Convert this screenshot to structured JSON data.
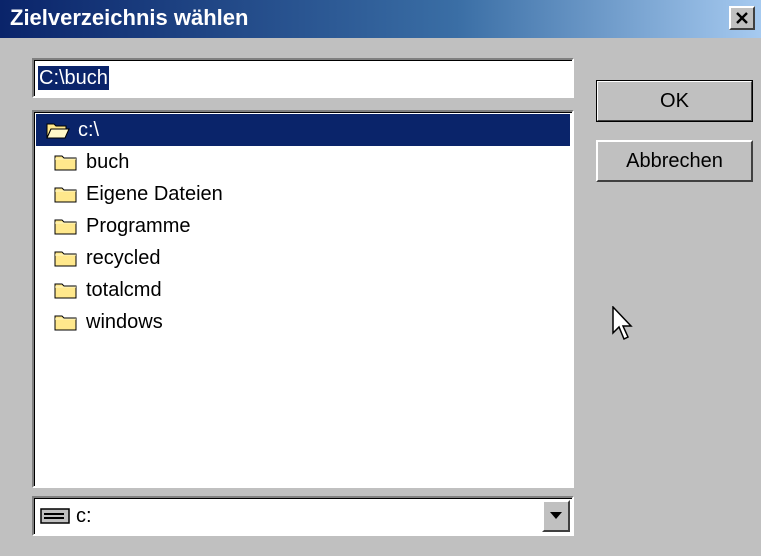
{
  "window": {
    "title": "Zielverzeichnis wählen"
  },
  "path_input": {
    "value": "C:\\buch"
  },
  "folders": [
    {
      "label": "c:\\",
      "icon": "open-folder-icon",
      "selected": true
    },
    {
      "label": "buch",
      "icon": "folder-icon",
      "selected": false
    },
    {
      "label": "Eigene Dateien",
      "icon": "folder-icon",
      "selected": false
    },
    {
      "label": "Programme",
      "icon": "folder-icon",
      "selected": false
    },
    {
      "label": "recycled",
      "icon": "folder-icon",
      "selected": false
    },
    {
      "label": "totalcmd",
      "icon": "folder-icon",
      "selected": false
    },
    {
      "label": "windows",
      "icon": "folder-icon",
      "selected": false
    }
  ],
  "drive": {
    "value": "c:",
    "icon": "drive-icon"
  },
  "buttons": {
    "ok": "OK",
    "cancel": "Abbrechen"
  },
  "colors": {
    "title_bar_start": "#0a246a",
    "title_bar_end": "#a6caf0",
    "selection": "#0a246a",
    "face": "#c0c0c0",
    "folder": "#ffe88c"
  }
}
